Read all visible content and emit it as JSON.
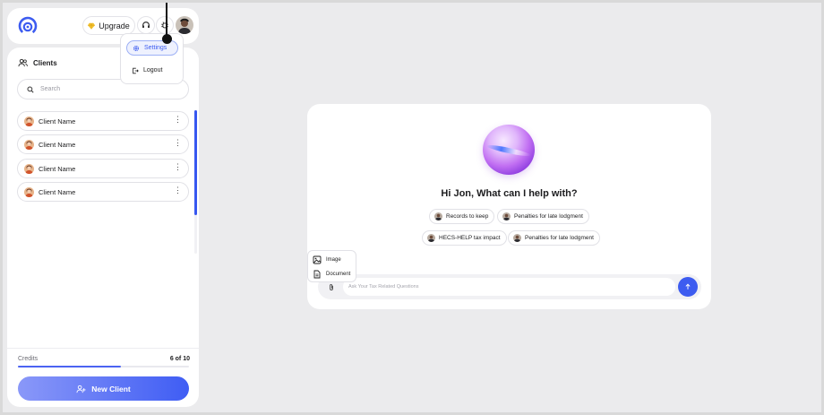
{
  "topbar": {
    "upgrade_label": "Upgrade",
    "icons": [
      "logo-icon",
      "gem-icon",
      "headset-icon",
      "bug-icon"
    ]
  },
  "profile_menu": {
    "settings_label": "Settings",
    "logout_label": "Logout"
  },
  "sidebar": {
    "title": "Clients",
    "search_placeholder": "Search",
    "clients": [
      {
        "name": "Client Name"
      },
      {
        "name": "Client Name"
      },
      {
        "name": "Client Name"
      },
      {
        "name": "Client Name"
      }
    ],
    "credits_label": "Credits",
    "credits_value": "6 of 10",
    "credits_fraction": 0.6,
    "new_client_label": "New Client"
  },
  "main": {
    "greeting": "Hi Jon, What can I help with?",
    "suggestions": [
      "Records to keep",
      "Penalties for late lodgment",
      "HECS-HELP tax impact",
      "Penalties for late lodgment"
    ],
    "input_placeholder": "Ask Your Tax Related Questions",
    "upload_menu": {
      "image_label": "Image",
      "document_label": "Document"
    }
  },
  "colors": {
    "accent": "#3d5cf0",
    "background": "#ebebed"
  }
}
